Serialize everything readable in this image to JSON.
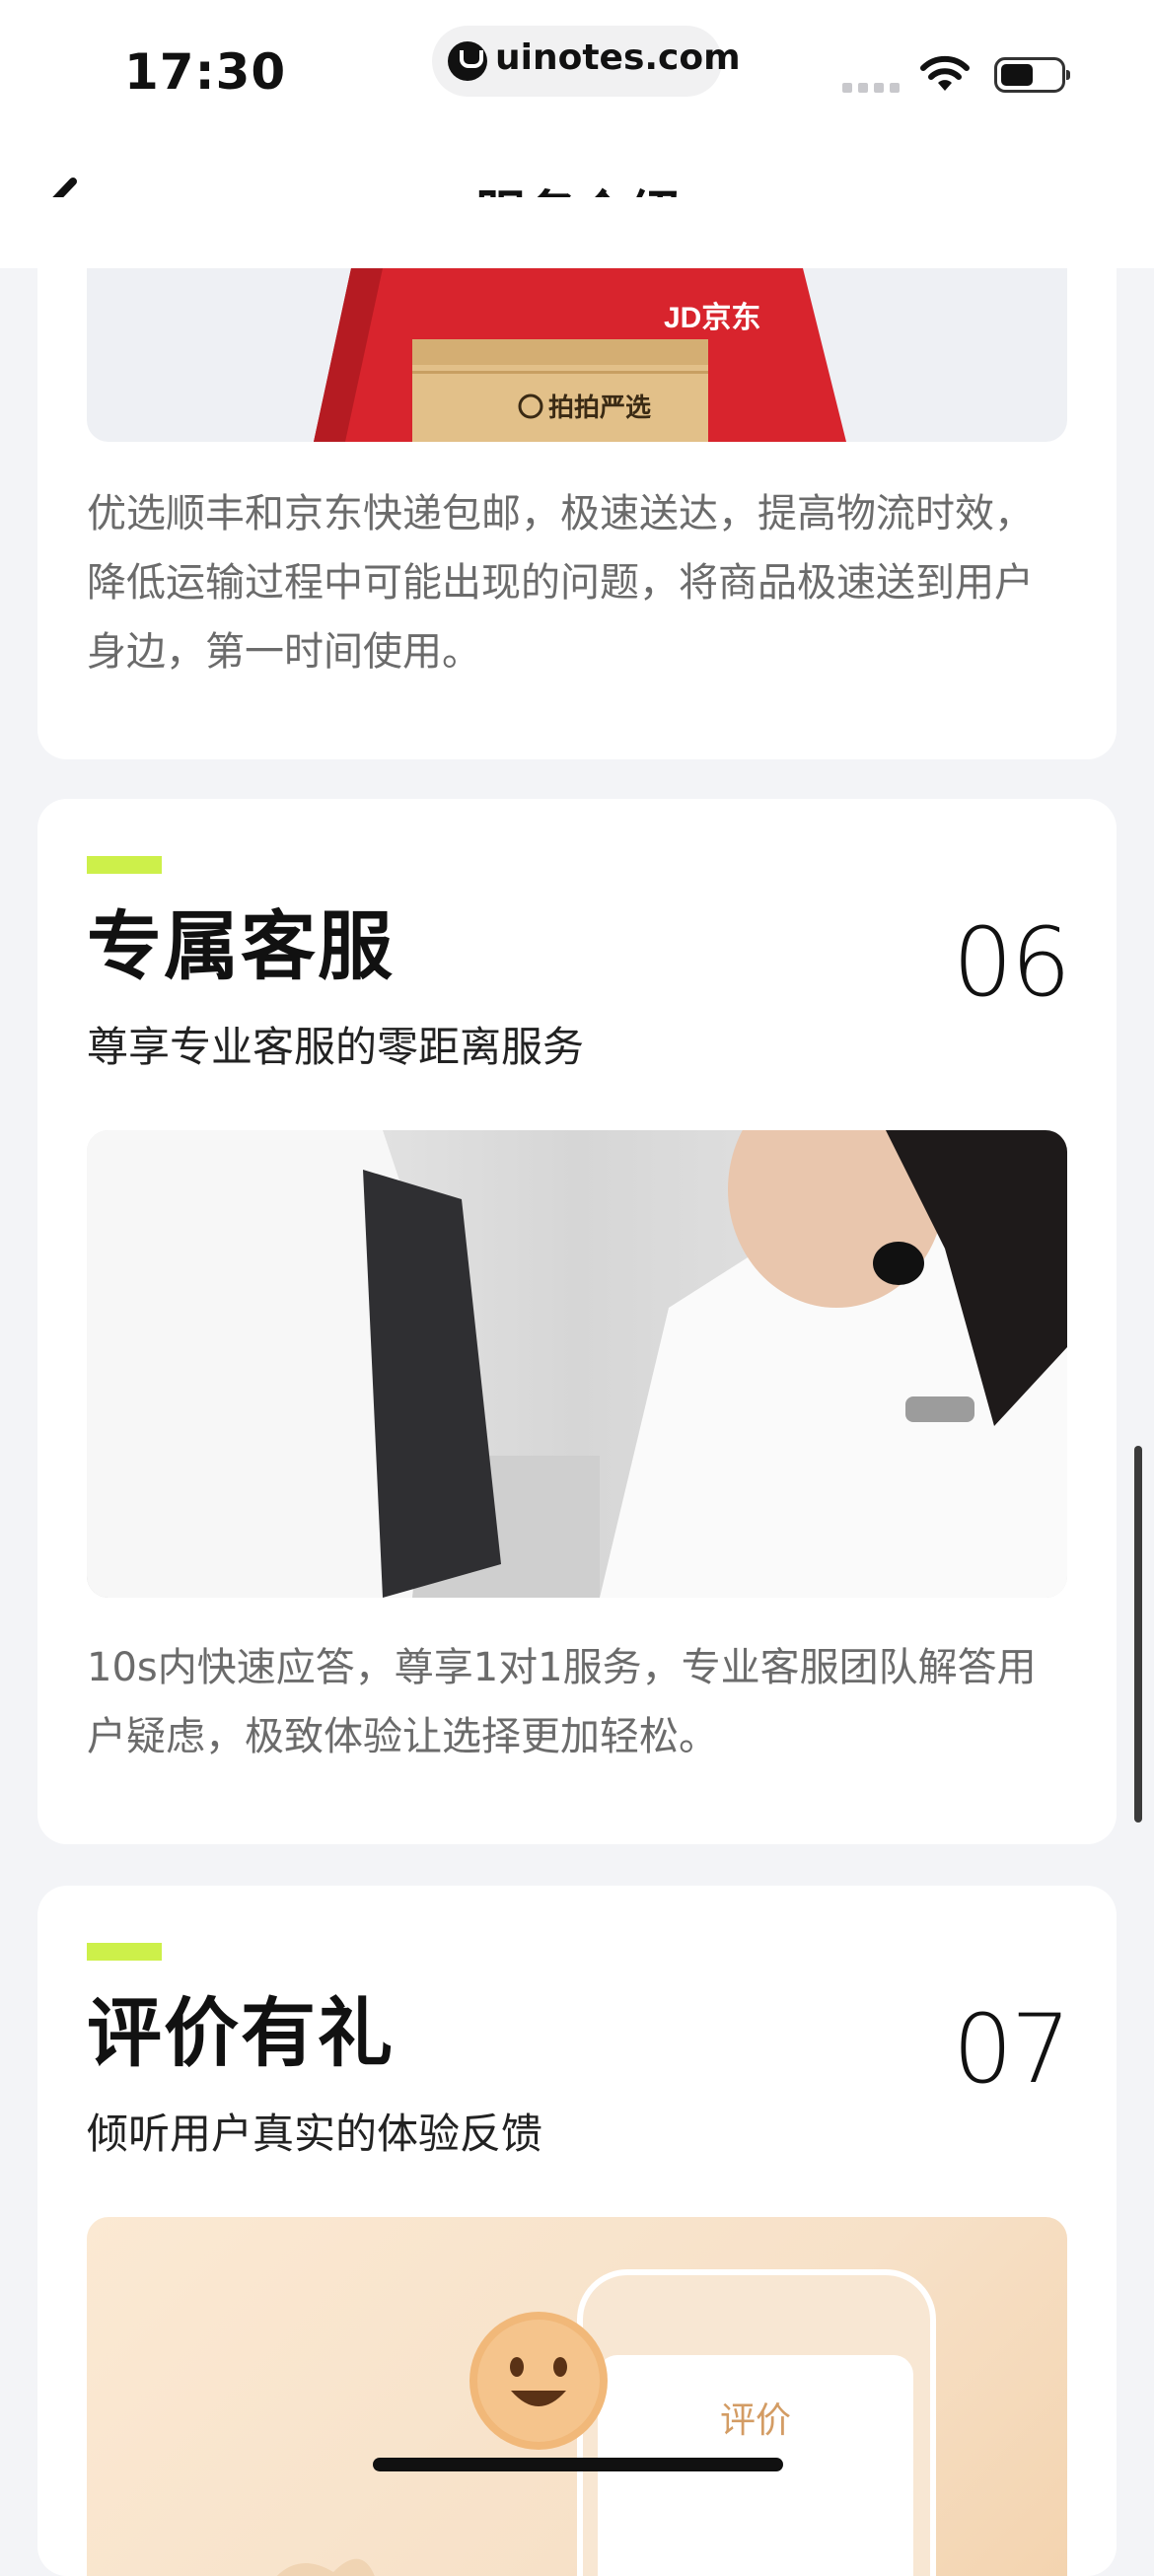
{
  "status_bar": {
    "time": "17:30",
    "url": "uinotes.com"
  },
  "nav": {
    "title": "服务介绍"
  },
  "cards": [
    {
      "image_caption": "拍拍严选",
      "image_badge": "JD京东",
      "description": "优选顺丰和京东快递包邮，极速送达，提高物流时效，降低运输过程中可能出现的问题，将商品极速送到用户身边，第一时间使用。"
    },
    {
      "title": "专属客服",
      "number": "06",
      "subtitle": "尊享专业客服的零距离服务",
      "description": "10s内快速应答，尊享1对1服务，专业客服团队解答用户疑虑，极致体验让选择更加轻松。"
    },
    {
      "title": "评价有礼",
      "number": "07",
      "subtitle": "倾听用户真实的体验反馈",
      "image_label": "评价"
    }
  ],
  "colors": {
    "accent": "#cdf04a",
    "background": "#f3f4f7",
    "card": "#ffffff"
  }
}
